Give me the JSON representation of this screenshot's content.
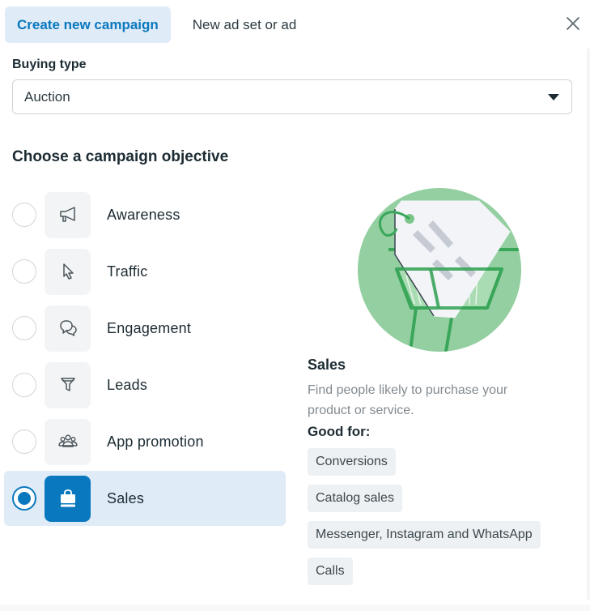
{
  "tabs": [
    {
      "label": "Create new campaign",
      "active": true
    },
    {
      "label": "New ad set or ad",
      "active": false
    }
  ],
  "close_icon": "close-icon",
  "buying_type": {
    "label": "Buying type",
    "value": "Auction",
    "icon": "caret-down-icon"
  },
  "objective_section": {
    "title": "Choose a campaign objective",
    "selected": "Sales",
    "items": [
      {
        "label": "Awareness",
        "icon": "megaphone-icon",
        "selected": false
      },
      {
        "label": "Traffic",
        "icon": "cursor-icon",
        "selected": false
      },
      {
        "label": "Engagement",
        "icon": "chat-bubbles-icon",
        "selected": false
      },
      {
        "label": "Leads",
        "icon": "funnel-icon",
        "selected": false
      },
      {
        "label": "App promotion",
        "icon": "people-group-icon",
        "selected": false
      },
      {
        "label": "Sales",
        "icon": "shopping-bag-icon",
        "selected": true
      }
    ]
  },
  "detail": {
    "illustration": "shopping-cart-price-tag-illustration",
    "title": "Sales",
    "description": "Find people likely to purchase your product or service.",
    "good_for_label": "Good for:",
    "good_for": [
      "Conversions",
      "Catalog sales",
      "Messenger, Instagram and WhatsApp",
      "Calls"
    ]
  },
  "colors": {
    "accent": "#0a78be",
    "selected_bg": "#dfebf7",
    "illustration_green": "#93cfa0",
    "illustration_dark_green": "#3aa65a"
  }
}
